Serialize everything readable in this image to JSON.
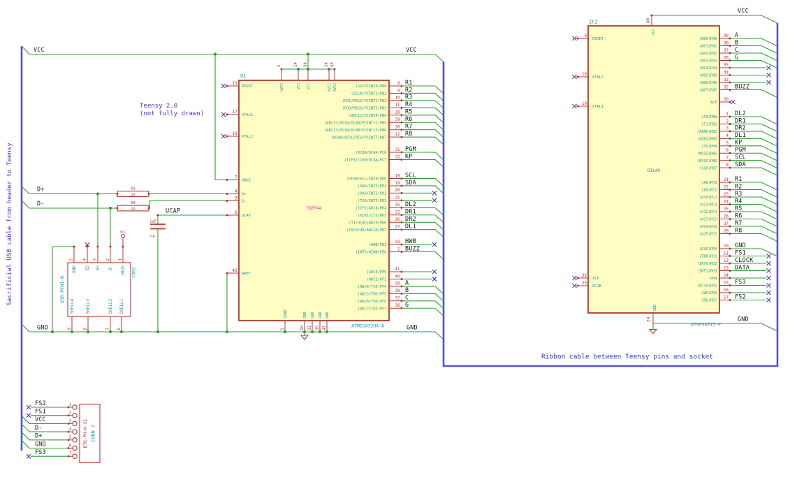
{
  "notes": {
    "teensy_line1": "Teensy 2.0",
    "teensy_line2": "(not fully drawn)",
    "ribbon": "Ribbon cable between Teensy pins and socket",
    "sacrificial": "Sacrificial USB cable from header to Teensy"
  },
  "labels": {
    "vcc_top_left": "VCC",
    "vcc_top_right": "VCC",
    "gnd_left_bus": "GND",
    "gnd_u1_right": "GND",
    "d_plus": "D+",
    "d_minus": "D-",
    "ucap": "UCAP",
    "vcc_ic2": "VCC",
    "gnd_ic2": "GND",
    "vcc_pin_symbol": "VCC"
  },
  "u1": {
    "ref": "U1",
    "value": "TQFP44",
    "part": "ATMEGA32U4-A",
    "left_pins": [
      {
        "num": "13",
        "name": "RESET",
        "conn": "nc"
      },
      {
        "num": "17",
        "name": "XTAL1",
        "conn": "nc"
      },
      {
        "num": "16",
        "name": "XTAL2",
        "conn": "nc"
      },
      {
        "num": "7",
        "name": "VBUS",
        "conn": "wire"
      },
      {
        "num": "4",
        "name": "D+",
        "conn": "wire"
      },
      {
        "num": "3",
        "name": "D-",
        "conn": "wire"
      },
      {
        "num": "6",
        "name": "UCAP",
        "conn": "wire"
      },
      {
        "num": "42",
        "name": "AREF",
        "conn": "wire"
      }
    ],
    "right_pins": [
      {
        "num": "8",
        "name": "(SS/PCINT0)PB0",
        "label": "R1",
        "conn": "bus"
      },
      {
        "num": "9",
        "name": "(SCLK/PCINT1)PB1",
        "label": "R2",
        "conn": "bus"
      },
      {
        "num": "10",
        "name": "(PDI/MOSI/PCINT2)PB2",
        "label": "R3",
        "conn": "bus"
      },
      {
        "num": "11",
        "name": "(PDO/MISO/PCINT3)PB3",
        "label": "R4",
        "conn": "bus"
      },
      {
        "num": "28",
        "name": "(ADC11/PCINT4)PB4",
        "label": "R5",
        "conn": "bus"
      },
      {
        "num": "29",
        "name": "(ADC12/OC1A/OC4B/PCINT12)PB5",
        "label": "R6",
        "conn": "bus"
      },
      {
        "num": "30",
        "name": "(ADC13/OC1B/OC4B/PCINT13)PB6",
        "label": "R7",
        "conn": "bus"
      },
      {
        "num": "12",
        "name": "(OC0A/OC1C/RTS/PCINT7)PB7",
        "label": "R8",
        "conn": "bus"
      },
      {
        "num": "31",
        "name": "(OC3A/OC4A)PC6",
        "label": "PGM",
        "conn": "bus"
      },
      {
        "num": "32",
        "name": "(ICP3/CLK0/OC4A)PC7",
        "label": "KP",
        "conn": "bus"
      },
      {
        "num": "18",
        "name": "(OC0B/SCL/INT0)PD0",
        "label": "SCL",
        "conn": "bus"
      },
      {
        "num": "19",
        "name": "(SDA/INT1)PD1",
        "label": "SDA",
        "conn": "bus"
      },
      {
        "num": "20",
        "name": "(RXD/INT2)PD2",
        "label": "",
        "conn": "nc"
      },
      {
        "num": "21",
        "name": "(TXD/INT3)PD3",
        "label": "",
        "conn": "nc"
      },
      {
        "num": "25",
        "name": "(ICP2/ADC8)PD4",
        "label": "DL2",
        "conn": "bus"
      },
      {
        "num": "22",
        "name": "(XCK1/CTS)PD5",
        "label": "DR1",
        "conn": "bus"
      },
      {
        "num": "26",
        "name": "(T1/OC4D/ADC9)PD6",
        "label": "DR2",
        "conn": "bus"
      },
      {
        "num": "27",
        "name": "(T0/OC4D/ADC10)PD7",
        "label": "DL1",
        "conn": "bus"
      },
      {
        "num": "33",
        "name": "(HWB)PE2",
        "label": "HWB",
        "conn": "nc"
      },
      {
        "num": "1",
        "name": "(INT6/AIN0)PE6",
        "label": "BUZZ",
        "conn": "bus"
      },
      {
        "num": "41",
        "name": "(ADC0)PF0",
        "label": "",
        "conn": "nc"
      },
      {
        "num": "40",
        "name": "(ADC1)PF1",
        "label": "",
        "conn": "nc"
      },
      {
        "num": "39",
        "name": "(ADC4/TCK)PF4",
        "label": "A",
        "conn": "bus"
      },
      {
        "num": "38",
        "name": "(ADC5/TMS)PF5",
        "label": "B",
        "conn": "bus"
      },
      {
        "num": "37",
        "name": "(ADC6/TDO)PF6",
        "label": "C",
        "conn": "bus"
      },
      {
        "num": "36",
        "name": "(ADC7/TDI)PF7",
        "label": "G",
        "conn": "bus"
      }
    ],
    "top_pins": [
      {
        "num": "2",
        "name": "UVCC"
      },
      {
        "num": "14",
        "name": "VCC"
      },
      {
        "num": "34",
        "name": "VCC"
      },
      {
        "num": "24",
        "name": "AVCC"
      },
      {
        "num": "44",
        "name": "AVCC"
      }
    ],
    "bottom_pins": [
      {
        "num": "5",
        "name": "UGND"
      },
      {
        "num": "15",
        "name": "GND"
      },
      {
        "num": "23",
        "name": "GND"
      },
      {
        "num": "35",
        "name": "GND"
      },
      {
        "num": "43",
        "name": "GND"
      }
    ]
  },
  "ic2": {
    "ref": "IC2",
    "value": "DIL40",
    "part": "AT90S8515-P",
    "top_pin": {
      "num": "40",
      "name": "VCC"
    },
    "bottom_pin": {
      "num": "20",
      "name": "GND"
    },
    "left_pins": [
      {
        "num": "9",
        "name": "RESET",
        "conn": "nc"
      },
      {
        "num": "18",
        "name": "XTAL2",
        "conn": "nc"
      },
      {
        "num": "19",
        "name": "XTAL1",
        "conn": "nc"
      },
      {
        "num": "31",
        "name": "ICP",
        "conn": "nc"
      },
      {
        "num": "29",
        "name": "OC1B",
        "conn": "nc"
      }
    ],
    "right_pins": [
      {
        "num": "39",
        "name": "(AD0)PA0",
        "label": "A",
        "conn": "bus"
      },
      {
        "num": "38",
        "name": "(AD1)PA1",
        "label": "B",
        "conn": "bus"
      },
      {
        "num": "37",
        "name": "(AD2)PA2",
        "label": "C",
        "conn": "bus"
      },
      {
        "num": "36",
        "name": "(AD3)PA3",
        "label": "G",
        "conn": "bus"
      },
      {
        "num": "35",
        "name": "(AD4)PA4",
        "label": "",
        "conn": "nc"
      },
      {
        "num": "34",
        "name": "(AD5)PA5",
        "label": "",
        "conn": "nc"
      },
      {
        "num": "33",
        "name": "(AD6)PA6",
        "label": "",
        "conn": "nc"
      },
      {
        "num": "32",
        "name": "(AD7)PA7",
        "label": "BUZZ",
        "conn": "bus"
      },
      {
        "num": "30",
        "name": "ALE",
        "label": "",
        "conn": "ncs"
      },
      {
        "num": "1",
        "name": "(T0)PB0",
        "label": "DL2",
        "conn": "bus"
      },
      {
        "num": "2",
        "name": "(T1)PB1",
        "label": "DR1",
        "conn": "bus"
      },
      {
        "num": "3",
        "name": "(AIN0)PB2",
        "label": "DR2",
        "conn": "bus"
      },
      {
        "num": "4",
        "name": "(AIN1)PB3",
        "label": "DL1",
        "conn": "bus"
      },
      {
        "num": "5",
        "name": "(SS)PB4",
        "label": "KP",
        "conn": "bus"
      },
      {
        "num": "6",
        "name": "(MOSI)PB5",
        "label": "PGM",
        "conn": "bus"
      },
      {
        "num": "7",
        "name": "(MISO)PB6",
        "label": "SCL",
        "conn": "bus"
      },
      {
        "num": "8",
        "name": "(SCK)PB7",
        "label": "SDA",
        "conn": "bus"
      },
      {
        "num": "21",
        "name": "(A8)PC0",
        "label": "R1",
        "conn": "bus"
      },
      {
        "num": "22",
        "name": "(A9)PC1",
        "label": "R2",
        "conn": "bus"
      },
      {
        "num": "23",
        "name": "(A10)PC2",
        "label": "R3",
        "conn": "bus"
      },
      {
        "num": "24",
        "name": "(A11)PC3",
        "label": "R4",
        "conn": "bus"
      },
      {
        "num": "25",
        "name": "(A12)PC4",
        "label": "R5",
        "conn": "bus"
      },
      {
        "num": "26",
        "name": "(A13)PC5",
        "label": "R6",
        "conn": "bus"
      },
      {
        "num": "27",
        "name": "(A14)PC6",
        "label": "R7",
        "conn": "bus"
      },
      {
        "num": "28",
        "name": "(A15)PC7",
        "label": "R8",
        "conn": "bus"
      },
      {
        "num": "10",
        "name": "(RXD)PD0",
        "label": "GND",
        "conn": "bus"
      },
      {
        "num": "11",
        "name": "(TXD)PD1",
        "label": "FS1",
        "conn": "nc"
      },
      {
        "num": "12",
        "name": "(INT0)PD2",
        "label": "CLOCK",
        "conn": "nc"
      },
      {
        "num": "13",
        "name": "(INT1)PD3",
        "label": "DATA",
        "conn": "nc"
      },
      {
        "num": "14",
        "name": "PD4",
        "label": "",
        "conn": "nc"
      },
      {
        "num": "15",
        "name": "(OC1A)PD5",
        "label": "FS3",
        "conn": "nc"
      },
      {
        "num": "16",
        "name": "(WR)PD6",
        "label": "",
        "conn": "nc"
      },
      {
        "num": "17",
        "name": "(RD)PD7",
        "label": "FS2",
        "conn": "nc"
      }
    ]
  },
  "con1": {
    "ref": "CON1",
    "value": "USB-MINI-B",
    "top_pins": [
      {
        "num": "5",
        "name": "GND"
      },
      {
        "num": "4",
        "name": "ID"
      },
      {
        "num": "3",
        "name": "D+"
      },
      {
        "num": "2",
        "name": "D-"
      },
      {
        "num": "1",
        "name": "VBUS"
      }
    ],
    "bottom_pins": [
      {
        "num": "9",
        "name": "SHELL4"
      },
      {
        "num": "8",
        "name": "SHELL3"
      },
      {
        "num": "7",
        "name": "SHELL2"
      },
      {
        "num": "6",
        "name": "SHELL1"
      }
    ]
  },
  "conn7": {
    "ref": "CONN_7",
    "value": "B7K-PH-K-S1",
    "pins": [
      {
        "num": "1",
        "label": "FS2",
        "conn": "nc"
      },
      {
        "num": "2",
        "label": "FS1",
        "conn": "nc"
      },
      {
        "num": "3",
        "label": "VCC",
        "conn": "bus"
      },
      {
        "num": "4",
        "label": "D-",
        "conn": "bus"
      },
      {
        "num": "5",
        "label": "D+",
        "conn": "bus"
      },
      {
        "num": "6",
        "label": "GND",
        "conn": "bus"
      },
      {
        "num": "7",
        "label": "FS3",
        "conn": "nc"
      }
    ]
  },
  "r2": {
    "ref": "R2",
    "value": "22"
  },
  "r3": {
    "ref": "R3",
    "value": "22"
  },
  "c4": {
    "ref": "C4",
    "value": "1uF"
  },
  "colors": {
    "wire": "#2f9e2f",
    "bus": "#5252cf",
    "outline": "#a32121",
    "pinline": "#bb3333",
    "fill": "#fffdc1",
    "pin_name": "#169b9b",
    "pin_num": "#bd2b2b",
    "value": "#bf40bf",
    "label": "#161616",
    "note": "#3a3ad0",
    "no_connect": "#3b3bd0"
  }
}
